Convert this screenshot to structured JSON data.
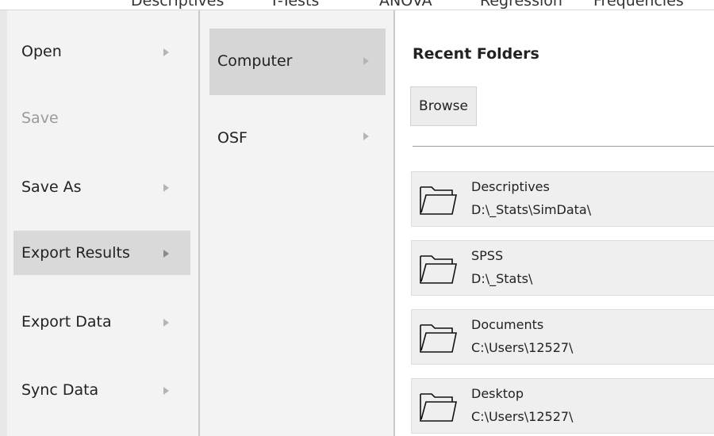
{
  "topbar": {
    "items": [
      "Descriptives",
      "T-Tests",
      "ANOVA",
      "Regression",
      "Frequencies"
    ]
  },
  "file_menu": {
    "items": [
      {
        "label": "Open",
        "disabled": false,
        "active": false
      },
      {
        "label": "Save",
        "disabled": true,
        "active": false
      },
      {
        "label": "Save As",
        "disabled": false,
        "active": false
      },
      {
        "label": "Export Results",
        "disabled": false,
        "active": true
      },
      {
        "label": "Export Data",
        "disabled": false,
        "active": false
      },
      {
        "label": "Sync Data",
        "disabled": false,
        "active": false
      }
    ]
  },
  "location_menu": {
    "items": [
      {
        "label": "Computer",
        "active": true
      },
      {
        "label": "OSF",
        "active": false
      }
    ]
  },
  "recent": {
    "title": "Recent Folders",
    "browse_label": "Browse",
    "folders": [
      {
        "name": "Descriptives",
        "path": "D:\\_Stats\\SimData\\"
      },
      {
        "name": "SPSS",
        "path": "D:\\_Stats\\"
      },
      {
        "name": "Documents",
        "path": "C:\\Users\\12527\\"
      },
      {
        "name": "Desktop",
        "path": "C:\\Users\\12527\\"
      }
    ]
  },
  "colors": {
    "panel_bg": "#f3f3f3",
    "active_item": "#d9d9d9",
    "disabled_text": "#9a9a9a"
  }
}
